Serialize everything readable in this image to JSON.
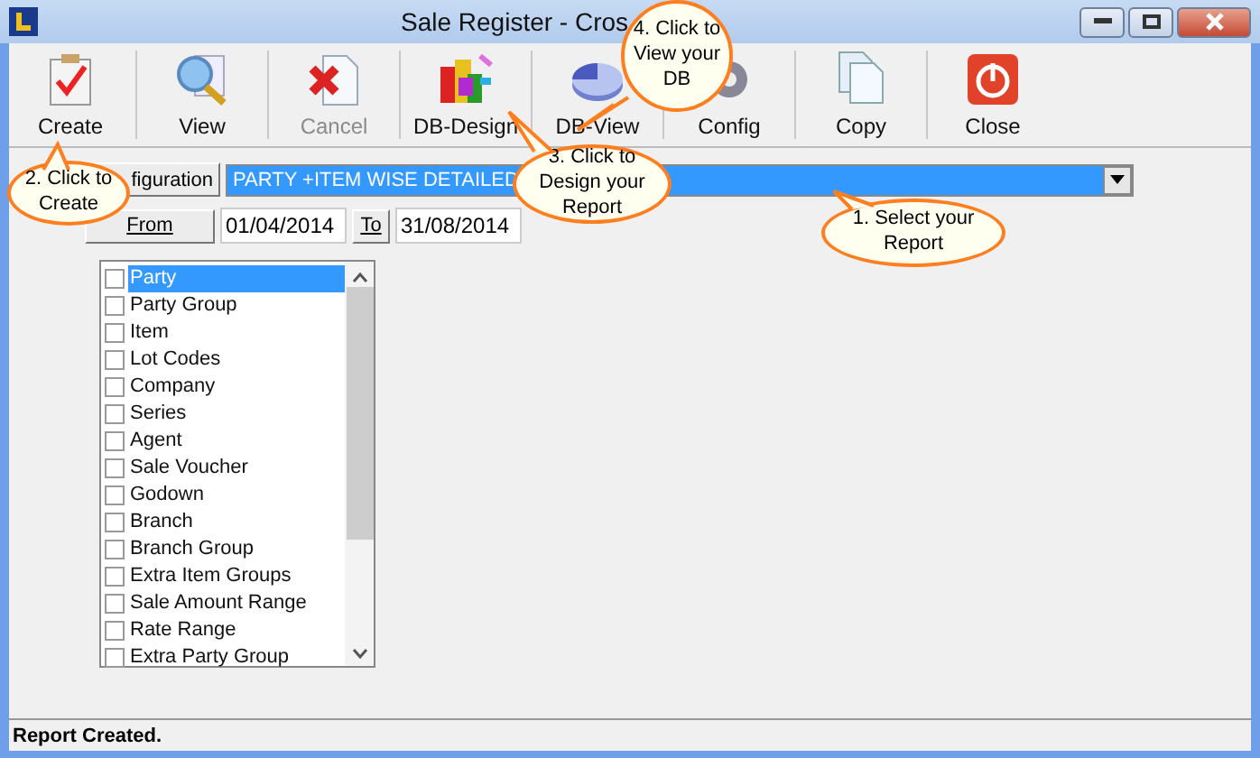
{
  "window": {
    "title": "Sale Register - Cros"
  },
  "toolbar": [
    {
      "label": "Create",
      "kind": "create",
      "disabled": false
    },
    {
      "label": "View",
      "kind": "view",
      "disabled": false
    },
    {
      "label": "Cancel",
      "kind": "cancel",
      "disabled": true
    },
    {
      "label": "DB-Design",
      "kind": "design",
      "disabled": false
    },
    {
      "label": "DB-View",
      "kind": "dbview",
      "disabled": false
    },
    {
      "label": "Config",
      "kind": "config",
      "disabled": false
    },
    {
      "label": "Copy",
      "kind": "copy",
      "disabled": false
    },
    {
      "label": "Close",
      "kind": "close",
      "disabled": false
    }
  ],
  "configuration": {
    "label": "figuration",
    "value": "PARTY +ITEM WISE DETAILED"
  },
  "date_range": {
    "from_label": "From",
    "from": "01/04/2014",
    "to_label": "To",
    "to": "31/08/2014"
  },
  "fields": [
    {
      "label": "Party",
      "checked": false,
      "selected": true
    },
    {
      "label": "Party Group",
      "checked": false,
      "selected": false
    },
    {
      "label": "Item",
      "checked": false,
      "selected": false
    },
    {
      "label": "Lot Codes",
      "checked": false,
      "selected": false
    },
    {
      "label": "Company",
      "checked": false,
      "selected": false
    },
    {
      "label": "Series",
      "checked": false,
      "selected": false
    },
    {
      "label": "Agent",
      "checked": false,
      "selected": false
    },
    {
      "label": "Sale Voucher",
      "checked": false,
      "selected": false
    },
    {
      "label": "Godown",
      "checked": false,
      "selected": false
    },
    {
      "label": "Branch",
      "checked": false,
      "selected": false
    },
    {
      "label": "Branch Group",
      "checked": false,
      "selected": false
    },
    {
      "label": "Extra Item Groups",
      "checked": false,
      "selected": false
    },
    {
      "label": "Sale Amount Range",
      "checked": false,
      "selected": false
    },
    {
      "label": "Rate Range",
      "checked": false,
      "selected": false
    },
    {
      "label": "Extra Party Group",
      "checked": false,
      "selected": false
    }
  ],
  "callouts": [
    {
      "text": "4. Click to View your DB",
      "kind": "dbview"
    },
    {
      "text": "2. Click to Create",
      "kind": "create"
    },
    {
      "text": "3. Click to Design your Report",
      "kind": "design"
    },
    {
      "text": "1. Select your Report",
      "kind": "select"
    }
  ],
  "status_bar": "Report Created."
}
